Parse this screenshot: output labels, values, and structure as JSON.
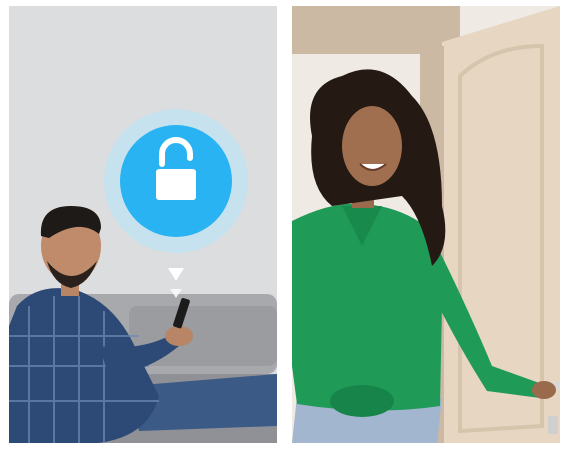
{
  "scene": {
    "left_panel": {
      "description_icon": "unlock-icon",
      "accent": "#29b3f2",
      "ring": "#bfe3f4",
      "arrow": "#ffffff",
      "wall": "#dcdddf",
      "sofa": "#9c9ea3",
      "shirt": "#2d4a77",
      "jeans": "#3b5a86"
    },
    "right_panel": {
      "door": "#e6d6c2",
      "frame": "#cbb9a3",
      "wall": "#efeae4",
      "shirt": "#1f9a57",
      "jeans": "#a3b6cf",
      "handle": "#d9d9d9"
    }
  }
}
